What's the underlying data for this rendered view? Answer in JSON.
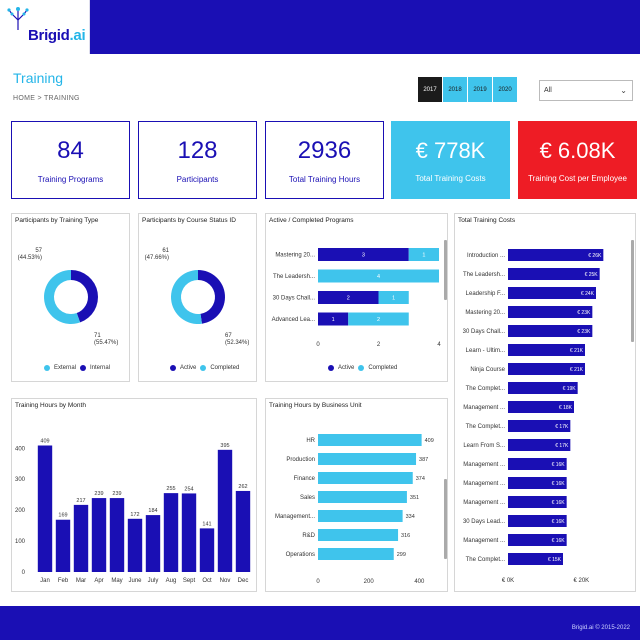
{
  "header": {
    "logo_main": "Brigid",
    "logo_ai": ".ai"
  },
  "page": {
    "title": "Training",
    "breadcrumb": "HOME > TRAINING"
  },
  "years": [
    "2017",
    "2018",
    "2019",
    "2020"
  ],
  "active_year": "2017",
  "filter": {
    "value": "All"
  },
  "kpis": [
    {
      "value": "84",
      "label": "Training Programs"
    },
    {
      "value": "128",
      "label": "Participants"
    },
    {
      "value": "2936",
      "label": "Total Training Hours"
    },
    {
      "value": "€ 778K",
      "label": "Total Training Costs"
    },
    {
      "value": "€ 6.08K",
      "label": "Training Cost per Employee"
    }
  ],
  "colors": {
    "navy": "#1a0fb4",
    "cyan": "#3fc4ec",
    "red": "#ee1c25"
  },
  "footer": {
    "text": "Brigid.ai © 2015-2022"
  },
  "chart_data": [
    {
      "type": "pie",
      "title": "Participants by Training Type",
      "series": [
        {
          "name": "Internal",
          "value": 57,
          "label": "57 (44.53%)",
          "color": "#1a0fb4"
        },
        {
          "name": "External",
          "value": 71,
          "label": "71 (55.47%)",
          "color": "#3fc4ec"
        }
      ],
      "legend": [
        "External",
        "Internal"
      ]
    },
    {
      "type": "pie",
      "title": "Participants by Course Status ID",
      "series": [
        {
          "name": "Active",
          "value": 61,
          "label": "61 (47.66%)",
          "color": "#1a0fb4"
        },
        {
          "name": "Completed",
          "value": 67,
          "label": "67 (52.34%)",
          "color": "#3fc4ec"
        }
      ],
      "legend": [
        "Active",
        "Completed"
      ]
    },
    {
      "type": "bar",
      "orientation": "horizontal",
      "stacked": true,
      "title": "Active / Completed Programs",
      "categories": [
        "Mastering 20...",
        "The Leadersh...",
        "30 Days Chall...",
        "Advanced Lea..."
      ],
      "series": [
        {
          "name": "Active",
          "values": [
            3,
            0,
            2,
            1
          ],
          "color": "#1a0fb4"
        },
        {
          "name": "Completed",
          "values": [
            1,
            4,
            1,
            2
          ],
          "color": "#3fc4ec"
        }
      ],
      "xticks": [
        "0",
        "2",
        "4"
      ],
      "xlim": [
        0,
        4
      ]
    },
    {
      "type": "bar",
      "orientation": "horizontal",
      "title": "Total Training Costs",
      "categories": [
        "Introduction ...",
        "The Leadersh...",
        "Leadership F...",
        "Mastering 20...",
        "30 Days Chall...",
        "Learn - Ultim...",
        "Ninja Course",
        "The Complet...",
        "Management ...",
        "The Complet...",
        "Learn From S...",
        "Management ...",
        "Management ...",
        "Management ...",
        "30 Days Lead...",
        "Management ...",
        "The Complet..."
      ],
      "values": [
        26,
        25,
        24,
        23,
        23,
        21,
        21,
        19,
        18,
        17,
        17,
        16,
        16,
        16,
        16,
        16,
        15
      ],
      "labels": [
        "€ 26K",
        "€ 25K",
        "€ 24K",
        "€ 23K",
        "€ 23K",
        "€ 21K",
        "€ 21K",
        "€ 19K",
        "€ 18K",
        "€ 17K",
        "€ 17K",
        "€ 16K",
        "€ 16K",
        "€ 16K",
        "€ 16K",
        "€ 16K",
        "€ 15K"
      ],
      "xticks": [
        "€ 0K",
        "€ 20K"
      ],
      "xlim": [
        0,
        30
      ],
      "color": "#1a0fb4"
    },
    {
      "type": "bar",
      "title": "Training Hours by Month",
      "categories": [
        "Jan",
        "Feb",
        "Mar",
        "Apr",
        "May",
        "June",
        "July",
        "Aug",
        "Sept",
        "Oct",
        "Nov",
        "Dec"
      ],
      "values": [
        409,
        169,
        217,
        239,
        239,
        172,
        184,
        255,
        254,
        141,
        395,
        262
      ],
      "yticks": [
        "0",
        "100",
        "200",
        "300",
        "400"
      ],
      "ylim": [
        0,
        430
      ],
      "color": "#1a0fb4"
    },
    {
      "type": "bar",
      "orientation": "horizontal",
      "title": "Training Hours by Business Unit",
      "categories": [
        "HR",
        "Production",
        "Finance",
        "Sales",
        "Management...",
        "R&D",
        "Operations"
      ],
      "values": [
        409,
        387,
        374,
        351,
        334,
        316,
        299
      ],
      "xticks": [
        "0",
        "200",
        "400"
      ],
      "xlim": [
        0,
        450
      ],
      "color": "#3fc4ec"
    }
  ]
}
